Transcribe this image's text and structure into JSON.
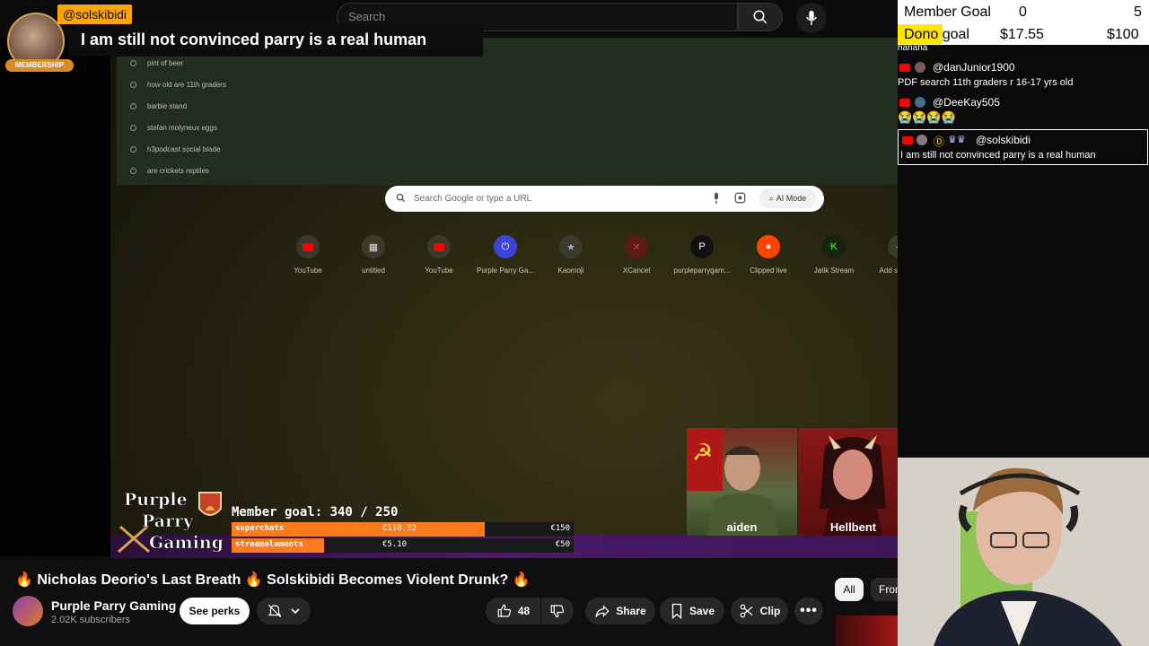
{
  "header": {
    "search_placeholder": "Search"
  },
  "overlay": {
    "username": "@solskibidi",
    "membership_badge": "MEMBERSHIP",
    "message": "I am still not convinced parry is a real human"
  },
  "browser": {
    "suggestions": [
      "pint of beer",
      "how old are 11th graders",
      "barbie stand",
      "stefan molyneux eggs",
      "h3podcast social blade",
      "are crickets reptiles"
    ],
    "google_placeholder": "Search Google or type a URL",
    "ai_mode_label": "AI Mode",
    "shortcuts": [
      {
        "label": "YouTube",
        "icon": "youtube-icon",
        "color": "#ff0000"
      },
      {
        "label": "untitled",
        "icon": "grid-icon",
        "color": "#5a6a5a"
      },
      {
        "label": "YouTube",
        "icon": "youtube-icon",
        "color": "#ff0000"
      },
      {
        "label": "Purple Parry Ga...",
        "icon": "purple-logo-icon",
        "color": "#3b44d6"
      },
      {
        "label": "Kaomoji",
        "icon": "star-icon",
        "color": "#8a86b8"
      },
      {
        "label": "XCancel",
        "icon": "x-icon",
        "color": "#7a2222"
      },
      {
        "label": "purpleparrygam...",
        "icon": "p-logo-icon",
        "color": "#111111"
      },
      {
        "label": "Clipped live",
        "icon": "reddit-icon",
        "color": "#ff4500"
      },
      {
        "label": "Jatik Stream",
        "icon": "kick-icon",
        "color": "#2ad414"
      },
      {
        "label": "Add shortcut",
        "icon": "plus-icon",
        "color": "#3a3a2a"
      }
    ]
  },
  "goals": {
    "member_label": "Member Goal",
    "member_current": "0",
    "member_target": "5",
    "dono_label_highlight": "Dono",
    "dono_label_rest": " goal",
    "dono_current": "$17.55",
    "dono_target": "$100"
  },
  "chat": {
    "top_fragment": "hahaha",
    "messages": [
      {
        "user": "@danJunior1900",
        "text": "PDF search 11th graders r 16-17 yrs old"
      },
      {
        "user": "@DeeKay505",
        "text": "😭😭😭😭"
      },
      {
        "user": "@solskibidi",
        "text": "I am still not convinced parry is a real human"
      }
    ]
  },
  "stream_overlay": {
    "logo_lines": [
      "Purple",
      "Parry",
      "Gaming"
    ],
    "member_goal_label": "Member goal: 340 / 250",
    "bars": [
      {
        "label": "superchats",
        "value": "€110.32",
        "goal": "€150",
        "fraction": 0.74,
        "color": "#ff7a1a"
      },
      {
        "label": "streamelements",
        "value": "€5.10",
        "goal": "€50",
        "fraction": 0.27,
        "color": "#ff7a1a"
      }
    ],
    "cams": [
      {
        "name": "aiden"
      },
      {
        "name": "Hellbent"
      }
    ]
  },
  "video": {
    "title": "🔥 Nicholas Deorio's Last Breath 🔥 Solskibidi Becomes Violent Drunk? 🔥",
    "channel_name": "Purple Parry Gaming",
    "subscribers": "2.02K subscribers",
    "see_perks": "See perks",
    "likes": "48",
    "share": "Share",
    "save": "Save",
    "clip": "Clip"
  },
  "filters": {
    "all": "All",
    "from": "From"
  }
}
